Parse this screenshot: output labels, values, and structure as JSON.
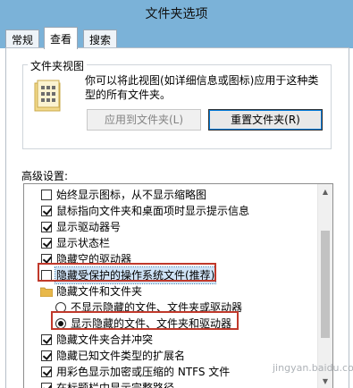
{
  "window": {
    "title": "文件夹选项"
  },
  "tabs": [
    {
      "label": "常规",
      "active": false
    },
    {
      "label": "查看",
      "active": true
    },
    {
      "label": "搜索",
      "active": false
    }
  ],
  "folder_views": {
    "group_label": "文件夹视图",
    "description": "你可以将此视图(如详细信息或图标)应用于这种类型的所有文件夹。",
    "apply_button": "应用到文件夹(L)",
    "reset_button": "重置文件夹(R)"
  },
  "advanced": {
    "label": "高级设置:",
    "items": [
      {
        "type": "checkbox",
        "label": "始终显示图标，从不显示缩略图",
        "checked": false
      },
      {
        "type": "checkbox",
        "label": "鼠标指向文件夹和桌面项时显示提示信息",
        "checked": true
      },
      {
        "type": "checkbox",
        "label": "显示驱动器号",
        "checked": true
      },
      {
        "type": "checkbox",
        "label": "显示状态栏",
        "checked": true
      },
      {
        "type": "checkbox",
        "label": "隐藏空的驱动器",
        "checked": true
      },
      {
        "type": "checkbox",
        "label": "隐藏受保护的操作系统文件(推荐)",
        "checked": false,
        "selected": true,
        "highlighted": true
      },
      {
        "type": "folder",
        "label": "隐藏文件和文件夹"
      },
      {
        "type": "radio",
        "label": "不显示隐藏的文件、文件夹或驱动器",
        "checked": false
      },
      {
        "type": "radio",
        "label": "显示隐藏的文件、文件夹和驱动器",
        "checked": true,
        "highlighted": true
      },
      {
        "type": "checkbox",
        "label": "隐藏文件夹合并冲突",
        "checked": true
      },
      {
        "type": "checkbox",
        "label": "隐藏已知文件类型的扩展名",
        "checked": true
      },
      {
        "type": "checkbox",
        "label": "用彩色显示加密或压缩的 NTFS 文件",
        "checked": true
      },
      {
        "type": "checkbox",
        "label": "在标题栏中显示完整路径",
        "checked": true
      }
    ]
  },
  "watermark": "jingyan.baidu.com",
  "colors": {
    "titlebar": "#7bb2d8",
    "highlight_box": "#c0392b",
    "selection": "#cfe3f7"
  }
}
